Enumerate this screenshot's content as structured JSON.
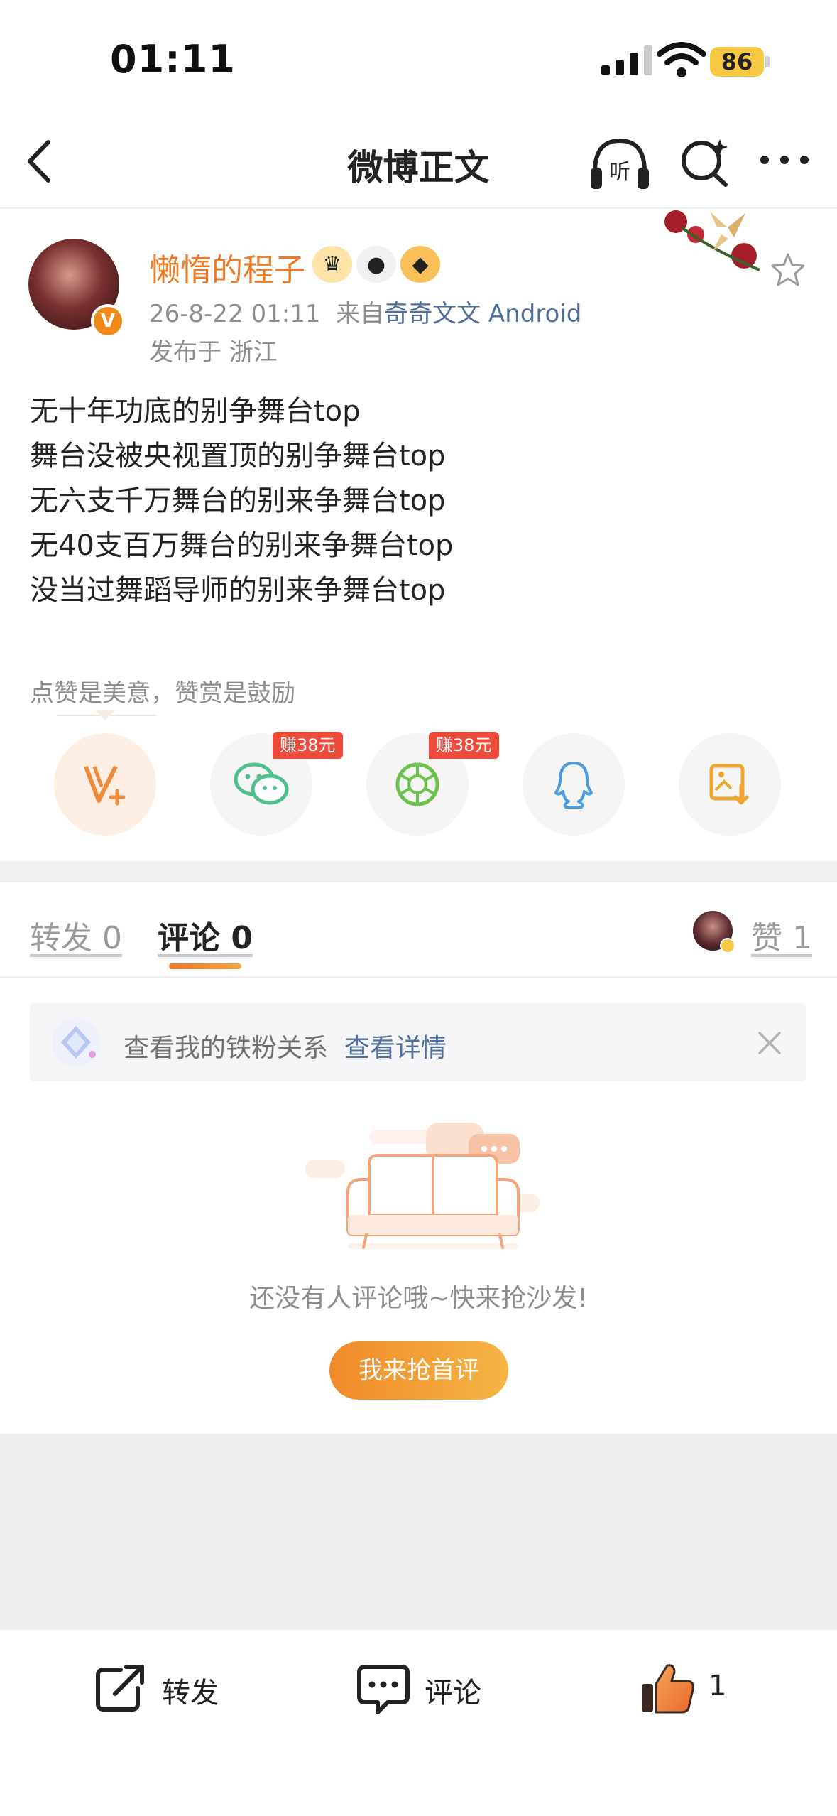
{
  "status_bar": {
    "time": "01:11",
    "battery": "86"
  },
  "nav": {
    "title": "微博正文"
  },
  "author": {
    "name": "懒惰的程子",
    "time": "26-8-22 01:11",
    "from_prefix": "来自",
    "source": "奇奇文文 Android",
    "location": "发布于 浙江",
    "verified_badge": "V"
  },
  "post": {
    "lines": [
      "无十年功底的别争舞台top",
      "舞台没被央视置顶的别争舞台top",
      "无六支千万舞台的别来争舞台top",
      "无40支百万舞台的别来争舞台top",
      "没当过舞蹈导师的别来争舞台top"
    ]
  },
  "reward": {
    "note": "点赞是美意，赞赏是鼓励"
  },
  "share": {
    "items": [
      {
        "name": "reward-icon",
        "tag": ""
      },
      {
        "name": "wechat-icon",
        "tag": "赚38元"
      },
      {
        "name": "moments-icon",
        "tag": "赚38元"
      },
      {
        "name": "qq-icon",
        "tag": ""
      },
      {
        "name": "save-image-icon",
        "tag": ""
      }
    ]
  },
  "tabs": {
    "repost": "转发 0",
    "comment": "评论 0",
    "likes": "赞 1"
  },
  "fan_banner": {
    "text": "查看我的铁粉关系",
    "link": "查看详情"
  },
  "empty": {
    "message": "还没有人评论哦~快来抢沙发!",
    "button": "我来抢首评"
  },
  "bottom_bar": {
    "repost": "转发",
    "comment": "评论",
    "like_count": "1"
  },
  "colors": {
    "accent": "#ee7a26",
    "link": "#4f6e99",
    "tag": "#ef4b3b"
  }
}
